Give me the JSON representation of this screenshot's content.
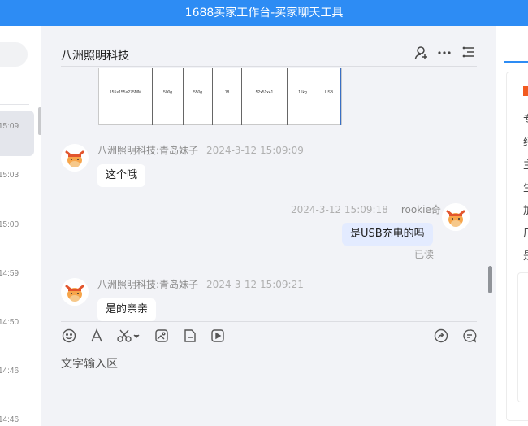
{
  "window": {
    "title": "1688买家工作台-买家聊天工具"
  },
  "session_list": {
    "times": [
      "15:09",
      "15:03",
      "15:00",
      "14:59",
      "14:50",
      "14:46",
      "14:46"
    ]
  },
  "chat": {
    "title": "八洲照明科技",
    "product_table": {
      "cells": [
        "155×155×275MM",
        "500g",
        "550g",
        "18",
        "52x51x41",
        "11kg",
        "USB"
      ]
    },
    "messages": [
      {
        "sender": "八洲照明科技:青岛妹子",
        "time": "2024-3-12 15:09:09",
        "text": "这个哦"
      },
      {
        "sender": "rookie奇",
        "time": "2024-3-12 15:09:18",
        "text": "是USB充电的吗",
        "status": "已读"
      },
      {
        "sender": "八洲照明科技:青岛妹子",
        "time": "2024-3-12 15:09:21",
        "text": "是的亲亲"
      }
    ],
    "input": {
      "placeholder": "文字输入区"
    }
  },
  "right_panel": {
    "labels": [
      "专",
      "经",
      "主",
      "生",
      "加",
      "厂",
      "是"
    ]
  },
  "colors": {
    "accent": "#2d8cf4",
    "mine_bubble": "#e3ebff",
    "chat_bg": "#f2f3f7"
  }
}
